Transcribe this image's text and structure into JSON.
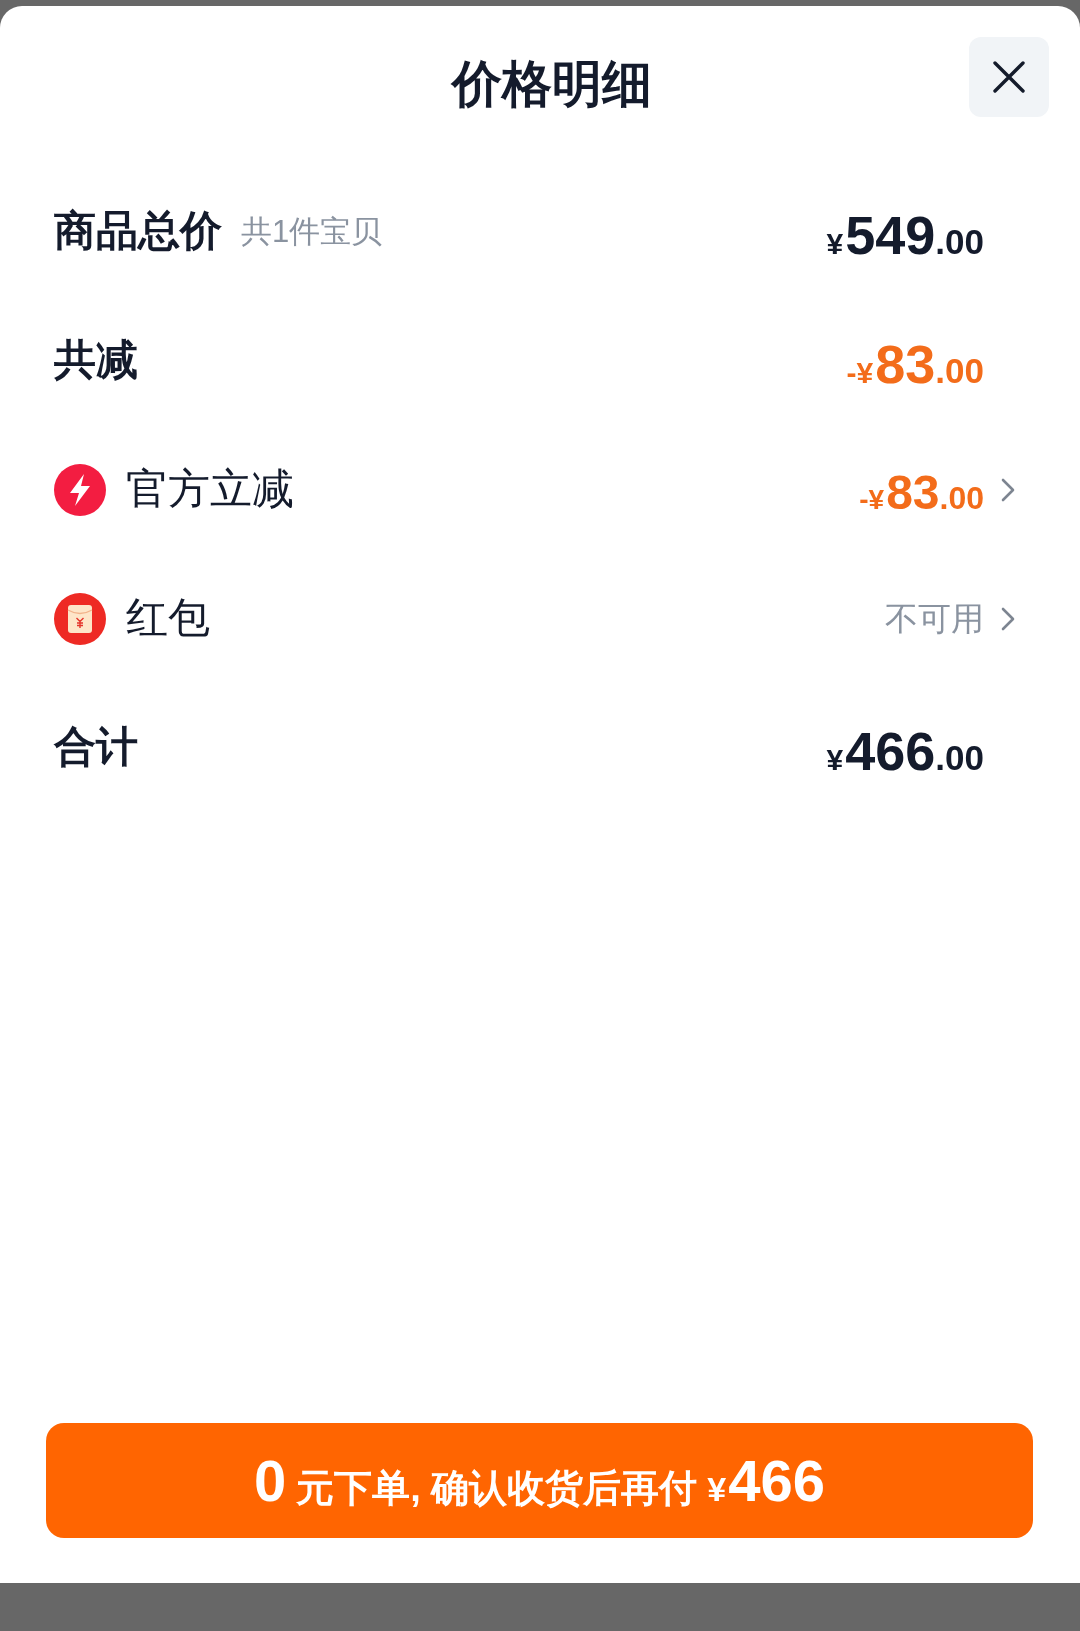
{
  "sheet": {
    "title": "价格明细"
  },
  "rows": [
    {
      "kind": "subtotal",
      "label": "商品总价",
      "note": "共1件宝贝",
      "amount": {
        "kind": "charge",
        "currency": "¥",
        "integer": "549",
        "fraction": ".00"
      }
    },
    {
      "kind": "reduction",
      "label": "共减",
      "amount": {
        "kind": "deduction",
        "currency": "-¥",
        "integer": "83",
        "fraction": ".00"
      }
    },
    {
      "kind": "instant-discount",
      "label": "官方立减",
      "amount": {
        "kind": "deduction",
        "currency": "-¥",
        "integer": "83",
        "fraction": ".00"
      }
    },
    {
      "kind": "red-packet",
      "label": "红包",
      "status": "不可用"
    },
    {
      "kind": "total",
      "label": "合计",
      "amount": {
        "kind": "charge",
        "currency": "¥",
        "integer": "466",
        "fraction": ".00"
      }
    }
  ],
  "action_button": {
    "parts": [
      {
        "kind": "number",
        "text": "0"
      },
      {
        "kind": "text",
        "text": "元下单, 确认收货后再付"
      },
      {
        "kind": "currency",
        "text": "¥"
      },
      {
        "kind": "number",
        "text": "466"
      }
    ]
  }
}
